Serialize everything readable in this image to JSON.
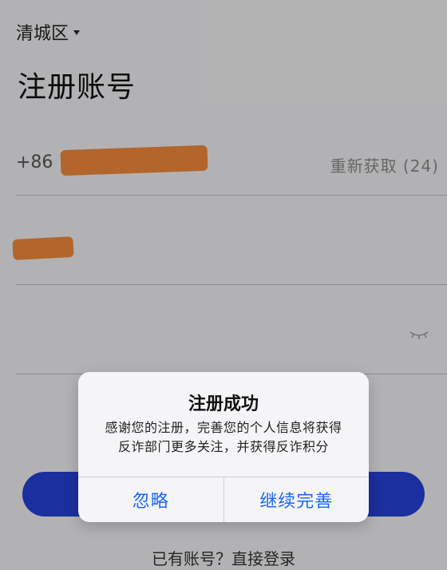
{
  "header": {
    "region_label": "清城区",
    "title": "注册账号"
  },
  "form": {
    "phone": {
      "country_code": "+86",
      "resend_label": "重新获取 (24)"
    }
  },
  "footer": {
    "login_link": "已有账号？直接登录"
  },
  "dialog": {
    "title": "注册成功",
    "message": "感谢您的注册，完善您的个人信息将获得反诈部门更多关注，并获得反诈积分",
    "actions": {
      "ignore": "忽略",
      "continue": "继续完善"
    }
  },
  "icons": {
    "region_dropdown": "chevron-down-icon",
    "password_visibility": "eye-closed-icon"
  },
  "colors": {
    "accent_blue": "#2540d6",
    "dialog_action_blue": "#1b66ff",
    "redaction_orange": "#f08a3a"
  }
}
